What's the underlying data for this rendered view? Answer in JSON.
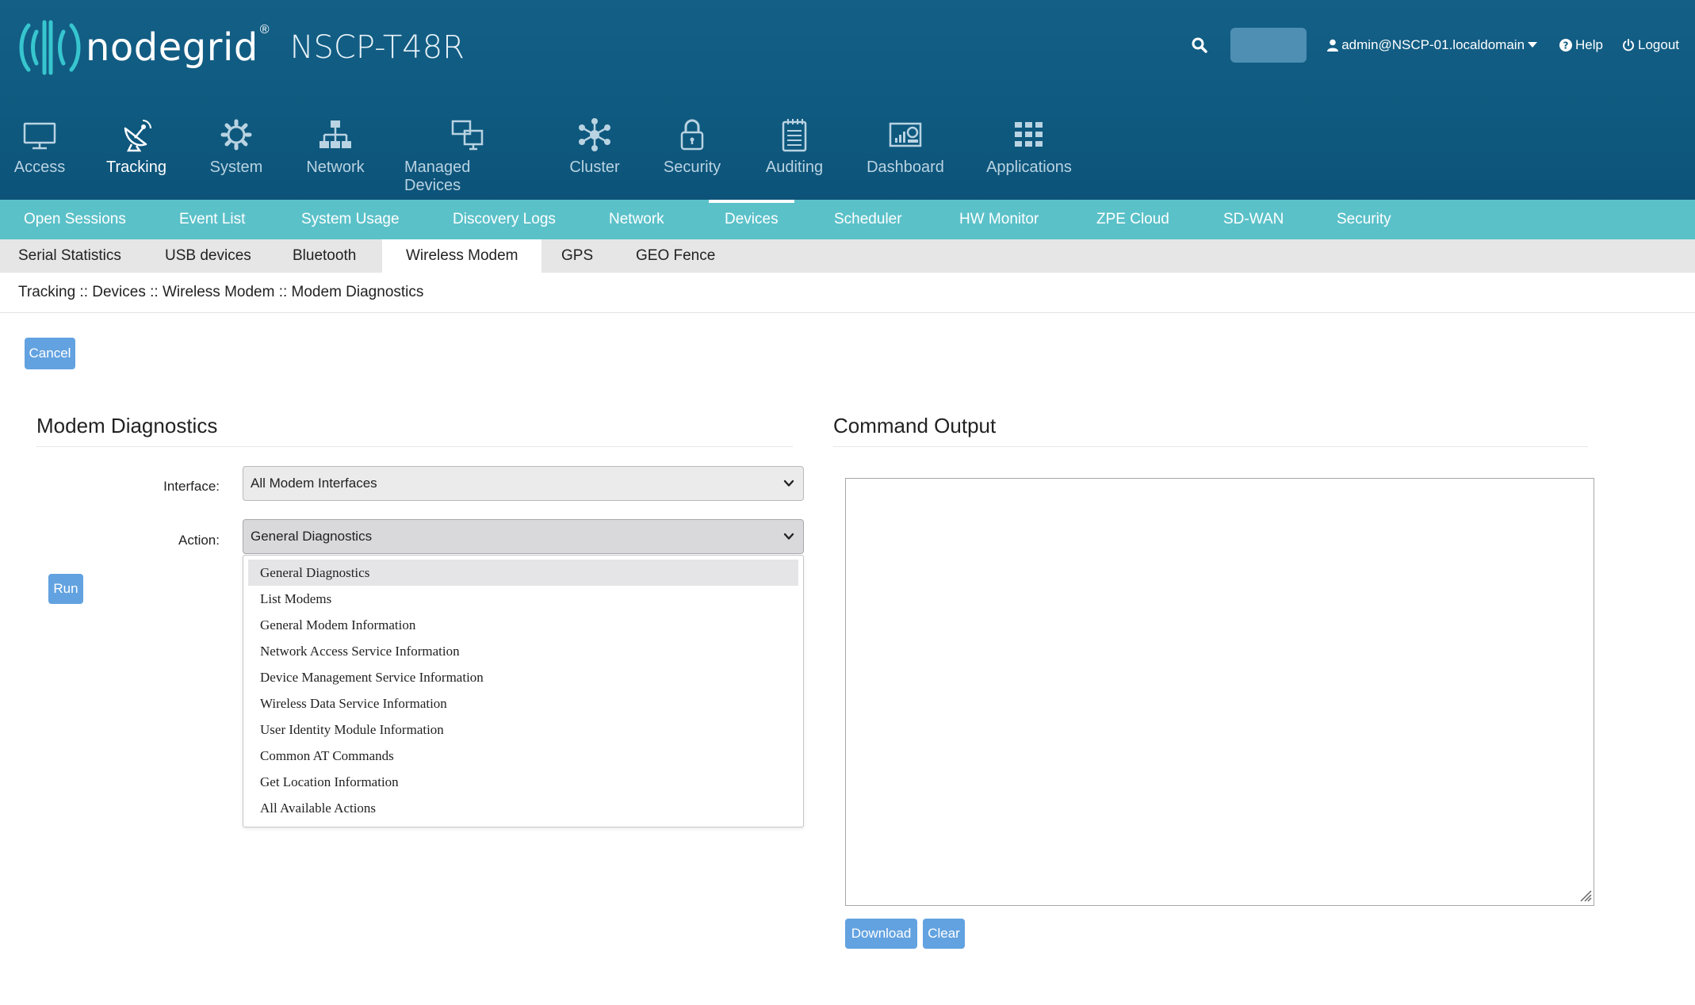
{
  "header": {
    "logo_text": "nodegrid",
    "logo_mark": "®",
    "product": "NSCP-T48R",
    "user": "admin@NSCP-01.localdomain",
    "help": "Help",
    "logout": "Logout"
  },
  "modules": [
    {
      "label": "Access",
      "icon": "monitor-icon"
    },
    {
      "label": "Tracking",
      "icon": "satellite-dish-icon"
    },
    {
      "label": "System",
      "icon": "gear-icon"
    },
    {
      "label": "Network",
      "icon": "network-tree-icon"
    },
    {
      "label": "Managed Devices",
      "icon": "devices-icon"
    },
    {
      "label": "Cluster",
      "icon": "cluster-icon"
    },
    {
      "label": "Security",
      "icon": "lock-icon"
    },
    {
      "label": "Auditing",
      "icon": "notepad-icon"
    },
    {
      "label": "Dashboard",
      "icon": "dashboard-icon"
    },
    {
      "label": "Applications",
      "icon": "grid-icon"
    }
  ],
  "nav2": [
    "Open Sessions",
    "Event List",
    "System Usage",
    "Discovery Logs",
    "Network",
    "Devices",
    "Scheduler",
    "HW Monitor",
    "ZPE Cloud",
    "SD-WAN",
    "Security"
  ],
  "nav3": [
    "Serial Statistics",
    "USB devices",
    "Bluetooth",
    "Wireless Modem",
    "GPS",
    "GEO Fence"
  ],
  "breadcrumb": "Tracking :: Devices :: Wireless Modem :: Modem Diagnostics",
  "buttons": {
    "cancel": "Cancel",
    "run": "Run",
    "download": "Download",
    "clear": "Clear"
  },
  "form": {
    "title": "Modem Diagnostics",
    "interface_label": "Interface:",
    "interface_value": "All Modem Interfaces",
    "action_label": "Action:",
    "action_value": "General Diagnostics",
    "action_options": [
      "General Diagnostics",
      "List Modems",
      "General Modem Information",
      "Network Access Service Information",
      "Device Management Service Information",
      "Wireless Data Service Information",
      "User Identity Module Information",
      "Common AT Commands",
      "Get Location Information",
      "All Available Actions"
    ]
  },
  "output": {
    "title": "Command Output",
    "value": ""
  },
  "colors": {
    "header": "#0f5a80",
    "teal_nav": "#5bc1c9",
    "button": "#62a2e0"
  }
}
